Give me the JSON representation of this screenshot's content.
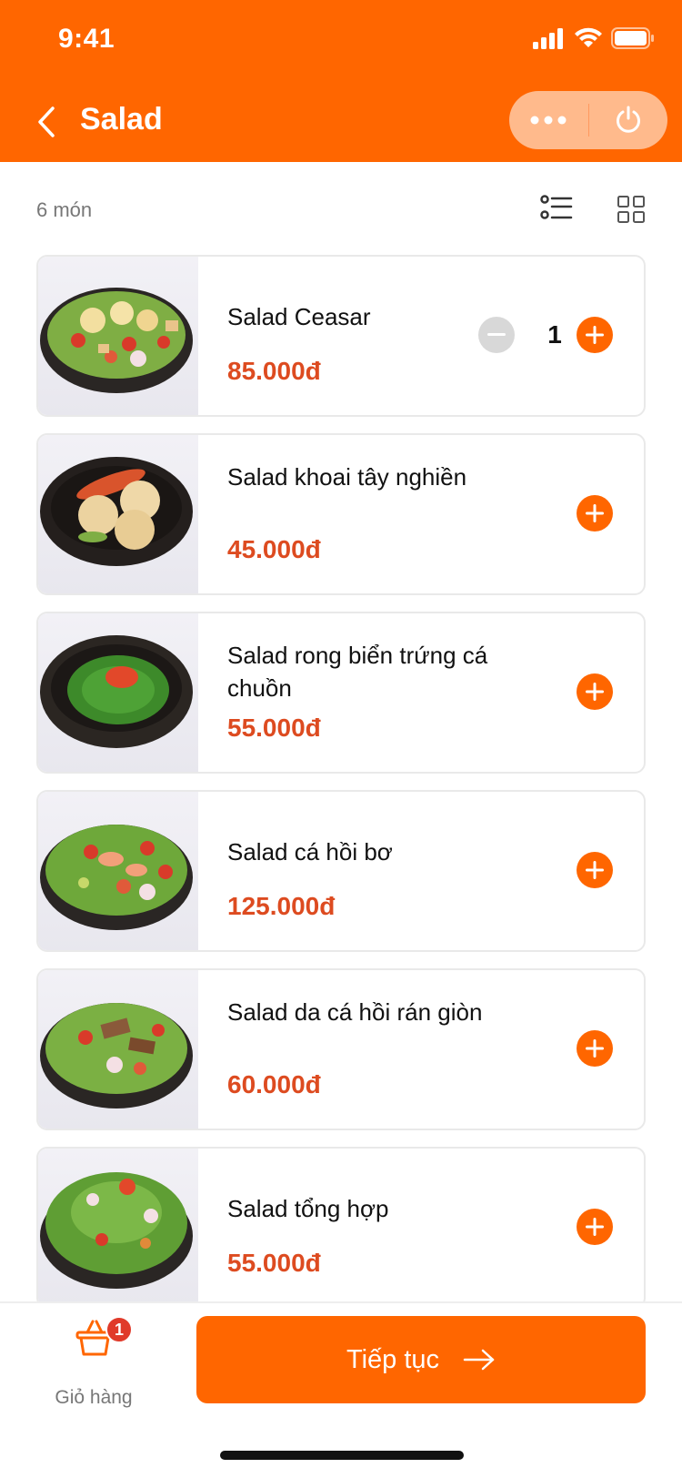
{
  "status_bar": {
    "time": "9:41"
  },
  "header": {
    "title": "Salad"
  },
  "toolbar": {
    "item_count": "6 món",
    "view_list_icon": "list-view-icon",
    "view_grid_icon": "grid-view-icon"
  },
  "colors": {
    "brand": "#FF6600",
    "price": "#DD4B20",
    "badge": "#E03A2A"
  },
  "items": [
    {
      "name": "Salad Ceasar",
      "price": "85.000đ",
      "quantity": "1"
    },
    {
      "name": "Salad khoai tây nghiền",
      "price": "45.000đ"
    },
    {
      "name": "Salad rong biển trứng cá chuồn",
      "price": "55.000đ"
    },
    {
      "name": "Salad cá hồi bơ",
      "price": "125.000đ"
    },
    {
      "name": "Salad da cá hồi rán giòn",
      "price": "60.000đ"
    },
    {
      "name": "Salad tổng hợp",
      "price": "55.000đ"
    }
  ],
  "bottom_bar": {
    "cart_label": "Giỏ hàng",
    "cart_count": "1",
    "continue_label": "Tiếp tục"
  }
}
